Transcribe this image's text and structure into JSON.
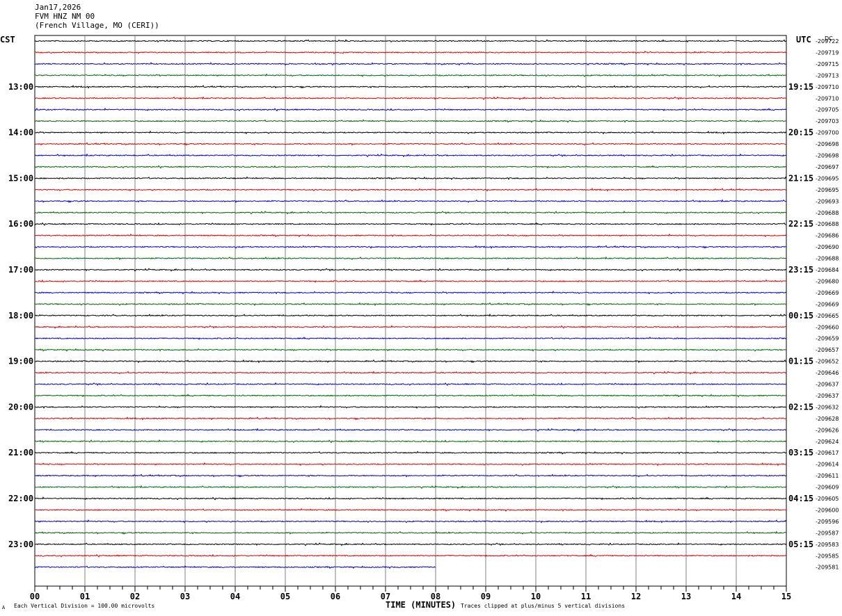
{
  "header": {
    "date": "Jan17,2026",
    "station": "FVM HNZ NM 00",
    "location": "(French Village, MO (CERI))"
  },
  "left_tz": "CST",
  "right_tz": "UTC",
  "dc_label": "DC",
  "footer": {
    "scale_note": "Each Vertical Division =  100.00 microvolts",
    "x_title": "TIME (MINUTES)",
    "clip_note": "Traces clipped at plus/minus 5 vertical divisions",
    "corner_mark": "A"
  },
  "colors": {
    "trace_cycle": [
      "#000000",
      "#dd0000",
      "#0000cc",
      "#006600"
    ],
    "grid": "#808080",
    "frame": "#000000"
  },
  "chart_data": {
    "type": "line",
    "title": "",
    "xlabel": "TIME (MINUTES)",
    "ylabel": "",
    "xlim": [
      0,
      15
    ],
    "x_ticks": [
      "00",
      "01",
      "02",
      "03",
      "04",
      "05",
      "06",
      "07",
      "08",
      "09",
      "10",
      "11",
      "12",
      "13",
      "14",
      "15"
    ],
    "row_interval_minutes": 15,
    "grid": true,
    "left_hour_labels": [
      "13:00",
      "14:00",
      "15:00",
      "16:00",
      "17:00",
      "18:00",
      "19:00",
      "20:00",
      "21:00",
      "22:00",
      "23:00"
    ],
    "right_hour_labels": [
      "19:15",
      "20:15",
      "21:15",
      "22:15",
      "23:15",
      "00:15",
      "01:15",
      "02:15",
      "03:15",
      "04:15",
      "05:15"
    ],
    "hour_label_first_row": 4,
    "hour_label_row_step": 4,
    "dc_offsets": [
      "-209722",
      "-209719",
      "-209715",
      "-209713",
      "-209710",
      "-209710",
      "-209705",
      "-209703",
      "-209700",
      "-209698",
      "-209698",
      "-209697",
      "-209695",
      "-209695",
      "-209693",
      "-209688",
      "-209688",
      "-209686",
      "-209690",
      "-209688",
      "-209684",
      "-209680",
      "-209669",
      "-209669",
      "-209665",
      "-209660",
      "-209659",
      "-209657",
      "-209652",
      "-209646",
      "-209637",
      "-209637",
      "-209632",
      "-209628",
      "-209626",
      "-209624",
      "-209617",
      "-209614",
      "-209611",
      "-209609",
      "-209605",
      "-209600",
      "-209596",
      "-209587",
      "-209583",
      "-209585",
      "-209581"
    ],
    "last_row_end_minute": 8.0
  }
}
